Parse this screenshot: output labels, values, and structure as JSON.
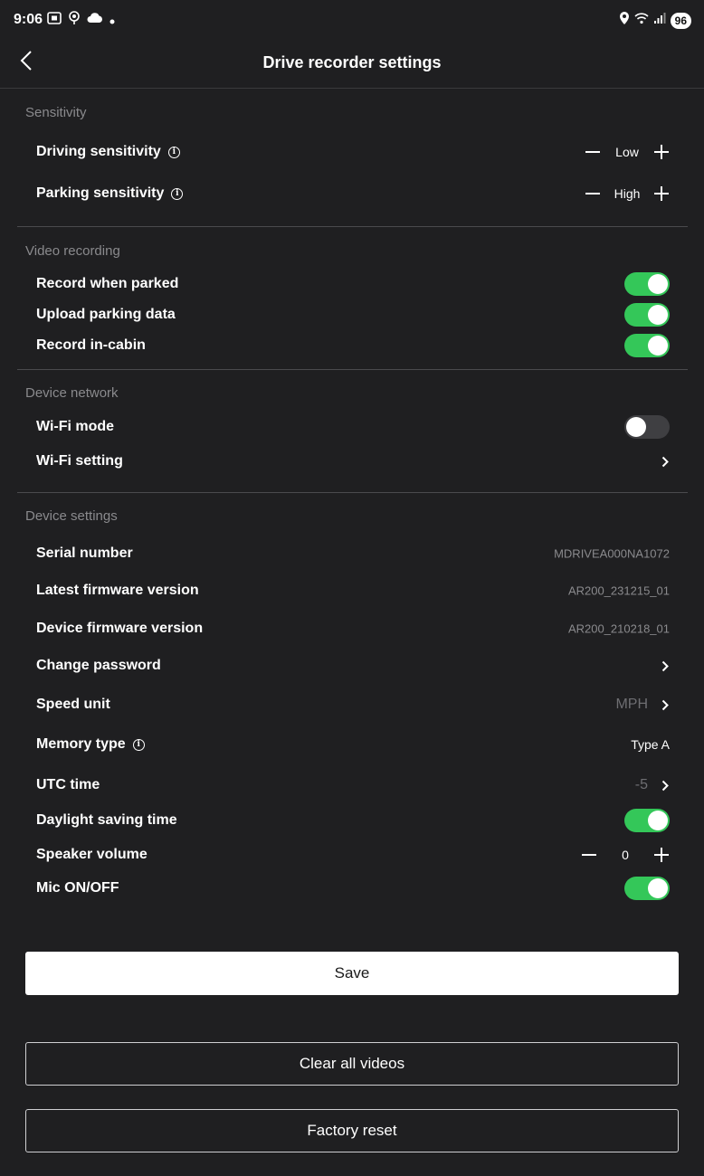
{
  "status_bar": {
    "time": "9:06",
    "battery": "96",
    "icons_left": [
      "screenshot-icon",
      "location-pin-icon",
      "cloud-icon",
      "dot-icon"
    ],
    "icons_right": [
      "location-icon",
      "wifi-icon",
      "signal-icon"
    ]
  },
  "header": {
    "title": "Drive recorder settings",
    "back_icon": "chevron-left-icon"
  },
  "sections": {
    "sensitivity": {
      "label": "Sensitivity",
      "driving": {
        "label": "Driving sensitivity",
        "value": "Low"
      },
      "parking": {
        "label": "Parking sensitivity",
        "value": "High"
      }
    },
    "video_recording": {
      "label": "Video recording",
      "record_parked": {
        "label": "Record when parked",
        "on": true
      },
      "upload_parking": {
        "label": "Upload parking data",
        "on": true
      },
      "record_cabin": {
        "label": "Record in-cabin",
        "on": true
      }
    },
    "device_network": {
      "label": "Device network",
      "wifi_mode": {
        "label": "Wi-Fi mode",
        "on": false
      },
      "wifi_setting": {
        "label": "Wi-Fi setting"
      }
    },
    "device_settings": {
      "label": "Device settings",
      "serial": {
        "label": "Serial number",
        "value": "MDRIVEA000NA1072"
      },
      "latest_fw": {
        "label": "Latest firmware version",
        "value": "AR200_231215_01"
      },
      "device_fw": {
        "label": "Device firmware version",
        "value": "AR200_210218_01"
      },
      "change_password": {
        "label": "Change password"
      },
      "speed_unit": {
        "label": "Speed unit",
        "value": "MPH"
      },
      "memory_type": {
        "label": "Memory type",
        "value": "Type A"
      },
      "utc_time": {
        "label": "UTC time",
        "value": "-5"
      },
      "dst": {
        "label": "Daylight saving time",
        "on": true
      },
      "speaker_volume": {
        "label": "Speaker volume",
        "value": "0"
      },
      "mic": {
        "label": "Mic ON/OFF",
        "on": true
      }
    }
  },
  "buttons": {
    "save": "Save",
    "clear_videos": "Clear all videos",
    "factory_reset": "Factory reset"
  },
  "colors": {
    "background": "#1f1f21",
    "toggle_on": "#34c759",
    "toggle_off": "#3f3f42",
    "section_label": "#8a8a8d"
  }
}
